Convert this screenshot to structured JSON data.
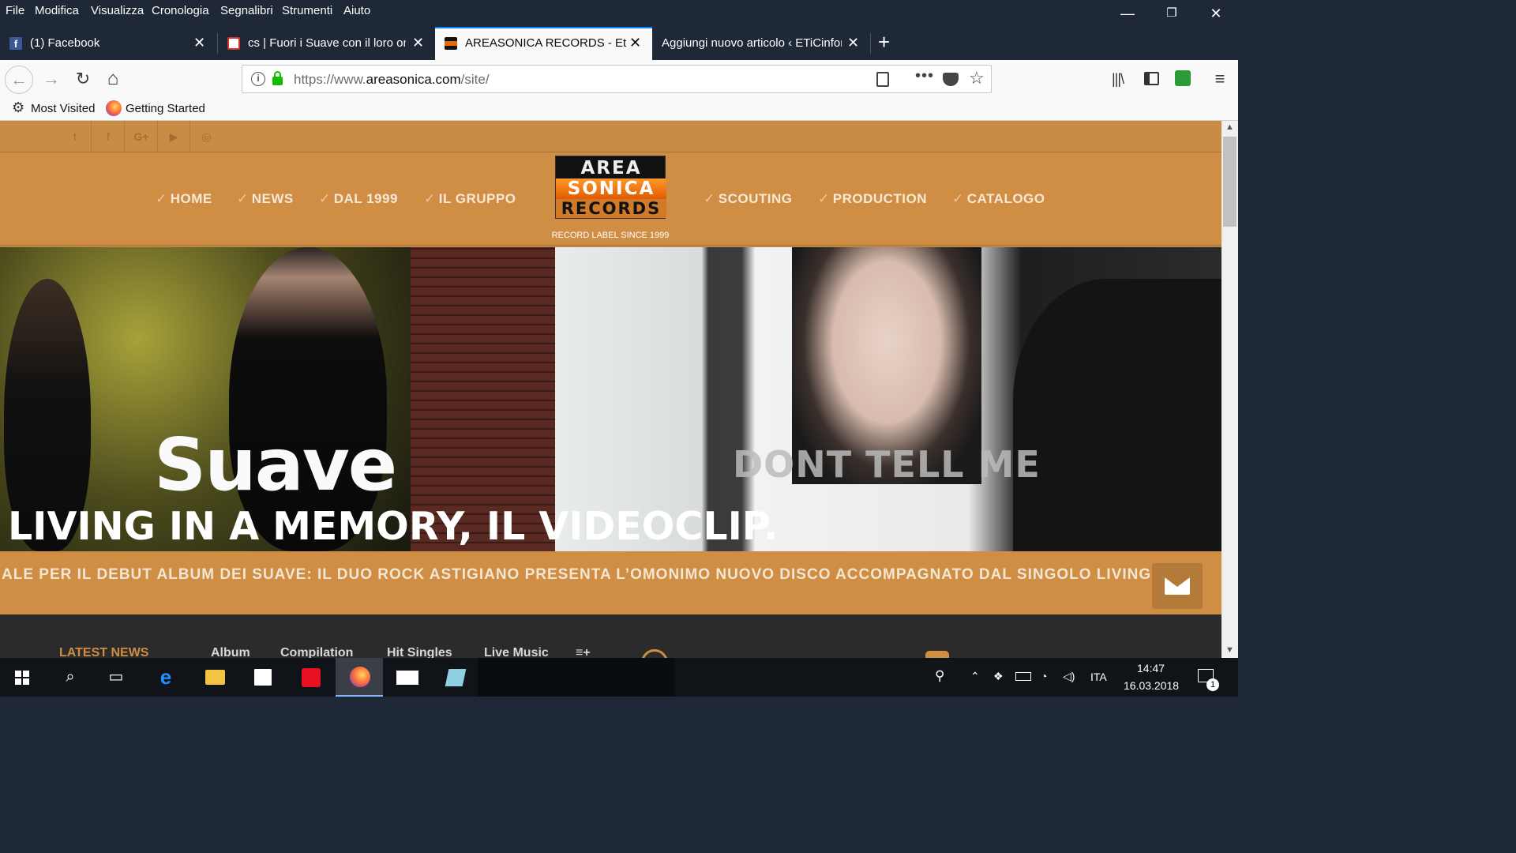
{
  "menubar": {
    "items": [
      "File",
      "Modifica",
      "Visualizza",
      "Cronologia",
      "Segnalibri",
      "Strumenti",
      "Aiuto"
    ]
  },
  "window_controls": {
    "minimize": "—",
    "restore": "❐",
    "close": "✕"
  },
  "tabs": [
    {
      "title": "(1) Facebook",
      "favicon_color": "#3b5998",
      "active": false
    },
    {
      "title": "cs | Fuori i Suave con il loro om",
      "favicon_color": "#d93025",
      "active": false
    },
    {
      "title": "AREASONICA RECORDS - Etiche",
      "favicon_color": "#c0392b",
      "active": true
    },
    {
      "title": "Aggiungi nuovo articolo ‹ ETiCinfor",
      "favicon_color": "",
      "active": false
    }
  ],
  "tab_close": "✕",
  "new_tab": "+",
  "navbar": {
    "back": "←",
    "forward": "→",
    "reload": "↻",
    "home": "⌂",
    "url_prefix": "https://www.",
    "url_domain": "areasonica.com",
    "url_path": "/site/",
    "menu": "≡"
  },
  "bookmarks": [
    {
      "label": "Most Visited",
      "icon": "gear-icon"
    },
    {
      "label": "Getting Started",
      "icon": "firefox-icon"
    }
  ],
  "site": {
    "social": [
      "t",
      "f",
      "G+",
      "▶",
      "◎"
    ],
    "nav_left": [
      "HOME",
      "NEWS",
      "DAL 1999",
      "IL GRUPPO"
    ],
    "nav_right": [
      "SCOUTING",
      "PRODUCTION",
      "CATALOGO"
    ],
    "check": "✓",
    "logo": {
      "line1": "AREA",
      "line2": "SONICA",
      "line3": "RECORDS"
    },
    "tagline": "RECORD LABEL SINCE 1999",
    "hero": {
      "title": "Suave",
      "subtitle": "LIVING IN A MEMORY, IL VIDEOCLIP.",
      "overlay_text": "DONT TELL ME"
    },
    "ticker": "ALE PER IL DEBUT ALBUM DEI SUAVE: IL DUO ROCK ASTIGIANO PRESENTA L’OMONIMO NUOVO DISCO ACCOMPAGNATO DAL SINGOLO LIVING IN",
    "bottom_tabs": [
      "LATEST NEWS",
      "Album",
      "Compilation",
      "Hit Singles",
      "Live Music",
      "≡+"
    ],
    "accent": "#d08d44"
  },
  "taskbar": {
    "lang": "ITA",
    "time": "14:47",
    "date": "16.03.2018",
    "notifications": "1"
  }
}
